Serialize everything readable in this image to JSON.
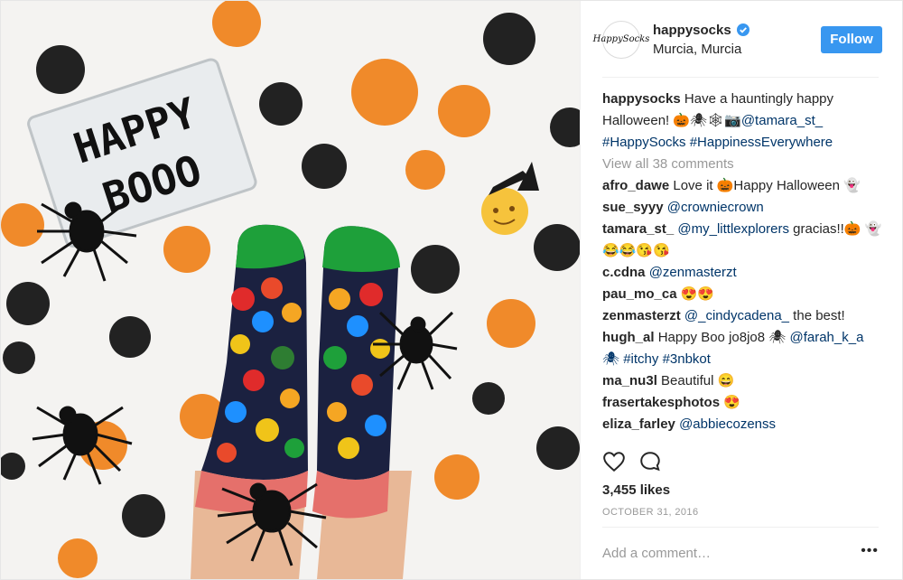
{
  "post": {
    "photo_alt": "happysocks halloween photo",
    "lightbox": {
      "line1": "HAPPY",
      "line2": "BOOO"
    }
  },
  "header": {
    "username": "happysocks",
    "location": "Murcia, Murcia",
    "follow_label": "Follow",
    "avatar_text": "HappySocks",
    "verified_color": "#3897f0"
  },
  "caption": {
    "username": "happysocks",
    "text": "Have a hauntingly happy Halloween! 🎃🕷🕸📷",
    "mention": "@tamara_st_",
    "hashtags": "#HappySocks #HappinessEverywhere"
  },
  "view_all": "View all 38 comments",
  "comments": [
    {
      "user": "afro_dawe",
      "text": "Love it 🎃Happy Halloween 👻",
      "link": ""
    },
    {
      "user": "sue_syyy",
      "text": "",
      "link": "@crowniecrown"
    },
    {
      "user": "tamara_st_",
      "text": " gracias!!🎃 👻😂😂😘😘",
      "link": "@my_littlexplorers"
    },
    {
      "user": "c.cdna",
      "text": "",
      "link": "@zenmasterzt"
    },
    {
      "user": "pau_mo_ca",
      "text": "😍😍",
      "link": ""
    },
    {
      "user": "zenmasterzt",
      "text": " the best!",
      "link": "@_cindycadena_"
    },
    {
      "user": "hugh_al",
      "text": "Happy Boo jo8jo8 🕷 ",
      "link": "@farah_k_a",
      "extra": "🕷 #itchy #3nbkot"
    },
    {
      "user": "ma_nu3l",
      "text": "Beautiful 😄",
      "link": ""
    },
    {
      "user": "frasertakesphotos",
      "text": "😍",
      "link": ""
    },
    {
      "user": "eliza_farley",
      "text": "",
      "link": "@abbiecozenss"
    }
  ],
  "likes": "3,455 likes",
  "date": "OCTOBER 31, 2016",
  "add_comment_placeholder": "Add a comment…",
  "more_label": "•••",
  "icons": {
    "like": "heart-icon",
    "comment": "comment-icon",
    "more": "more-options-icon",
    "verified": "verified-badge-icon"
  }
}
